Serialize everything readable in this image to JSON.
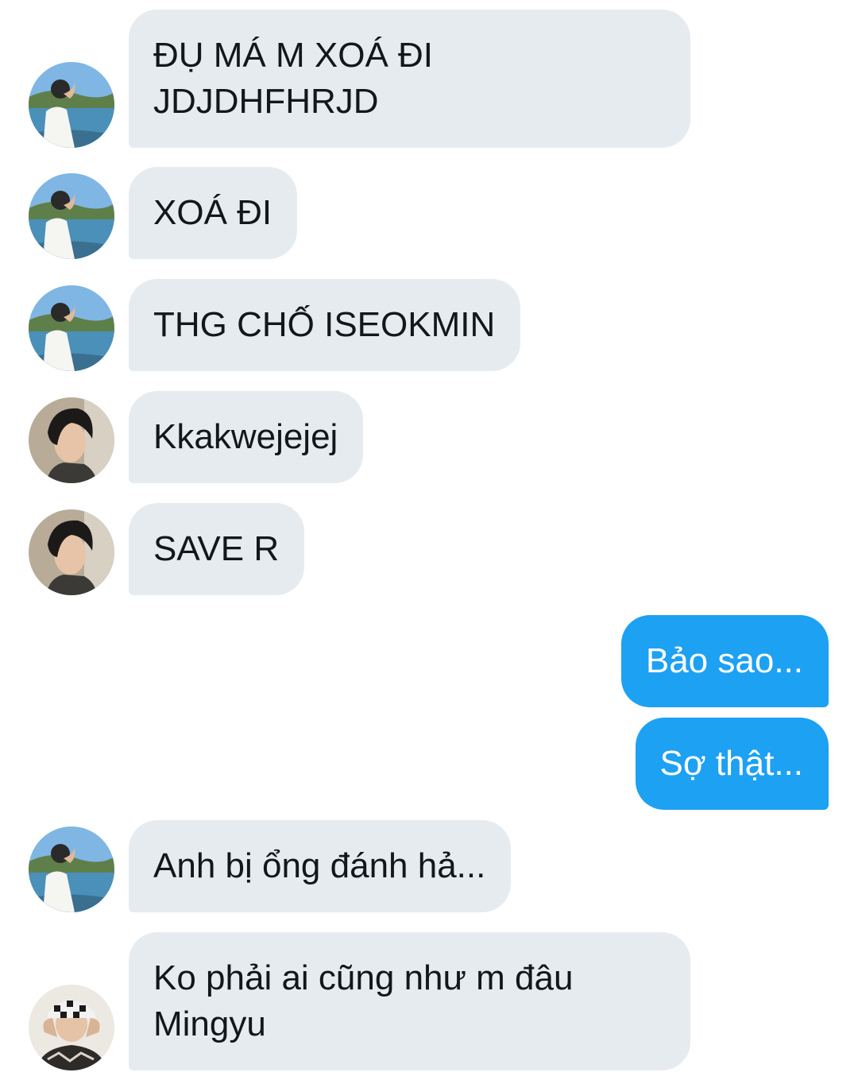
{
  "theme": {
    "incoming_bubble": "#e6ebf0",
    "outgoing_bubble": "#1da1f2",
    "incoming_text": "#14171a",
    "outgoing_text": "#ffffff"
  },
  "messages": [
    {
      "sender": "seokmin",
      "direction": "incoming",
      "text": "ĐỤ MÁ M XOÁ ĐI\nJDJDHFHRJD",
      "avatar_icon": "user-avatar-seaside-icon"
    },
    {
      "sender": "seokmin",
      "direction": "incoming",
      "text": "XOÁ ĐI",
      "avatar_icon": "user-avatar-seaside-icon"
    },
    {
      "sender": "seokmin",
      "direction": "incoming",
      "text": "THG CHỐ ISEOKMIN",
      "avatar_icon": "user-avatar-seaside-icon"
    },
    {
      "sender": "dark-hair",
      "direction": "incoming",
      "text": "Kkakwejejej",
      "avatar_icon": "user-avatar-dark-hair-icon"
    },
    {
      "sender": "dark-hair",
      "direction": "incoming",
      "text": "SAVE R",
      "avatar_icon": "user-avatar-dark-hair-icon"
    },
    {
      "sender": "me",
      "direction": "outgoing",
      "text": "Bảo sao..."
    },
    {
      "sender": "me",
      "direction": "outgoing",
      "text": "Sợ thật..."
    },
    {
      "sender": "seokmin",
      "direction": "incoming",
      "text": "Anh bị ổng đánh hả...",
      "avatar_icon": "user-avatar-seaside-icon"
    },
    {
      "sender": "checkered-hat",
      "direction": "incoming",
      "text": "Ko phải ai cũng như m đâu\nMingyu",
      "avatar_icon": "user-avatar-checkered-hat-icon"
    }
  ]
}
